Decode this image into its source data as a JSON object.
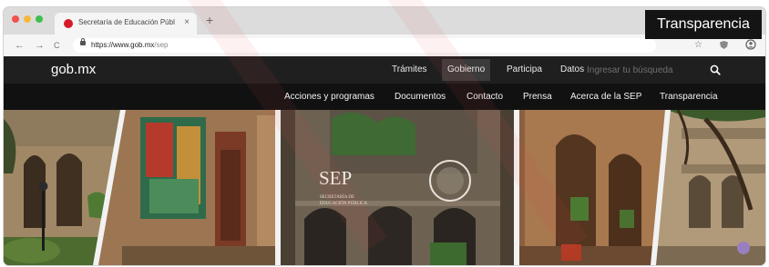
{
  "browser": {
    "tab_title": "Secretaría de Educación Públ",
    "tab_close": "×",
    "new_tab": "+",
    "back_glyph": "←",
    "forward_glyph": "→",
    "reload_glyph": "C",
    "url_host": "https://www.gob.mx",
    "url_path": "/sep",
    "star_glyph": "☆"
  },
  "overlay_label": "Transparencia",
  "site": {
    "logo": "gob.mx",
    "nav_primary": [
      "Trámites",
      "Gobierno",
      "Participa",
      "Datos"
    ],
    "search_placeholder": "Ingresar tu búsqueda",
    "nav_secondary": [
      "Acciones y programas",
      "Documentos",
      "Contacto",
      "Prensa",
      "Acerca de la SEP",
      "Transparencia"
    ]
  },
  "hero": {
    "logo_text": "SEP",
    "logo_sub_1": "SECRETARÍA DE",
    "logo_sub_2": "EDUCACIÓN PÚBLICA"
  }
}
